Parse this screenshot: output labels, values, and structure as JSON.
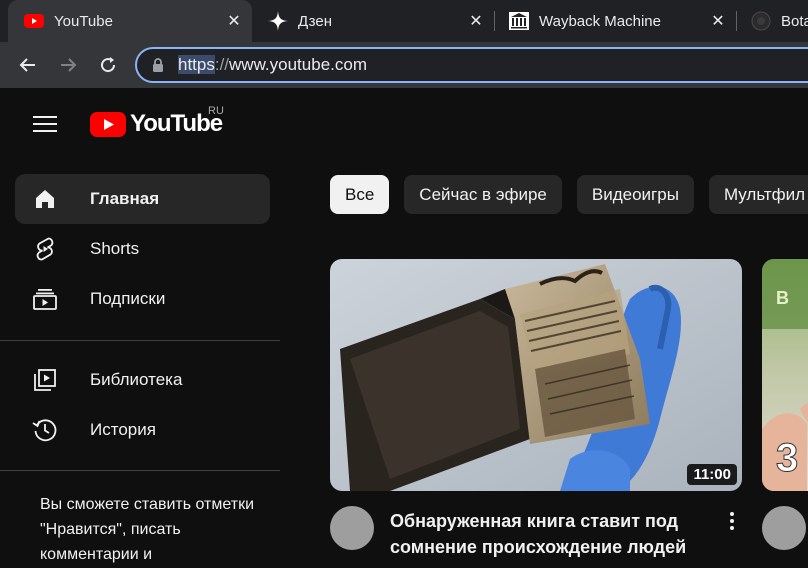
{
  "browser": {
    "tabs": [
      {
        "title": "YouTube",
        "active": true
      },
      {
        "title": "Дзен",
        "active": false
      },
      {
        "title": "Wayback Machine",
        "active": false
      },
      {
        "title": "Bota",
        "active": false
      }
    ],
    "url": {
      "selected": "https",
      "separator": "://",
      "rest": "www.youtube.com"
    }
  },
  "youtube": {
    "logo_text": "YouTube",
    "region": "RU",
    "sidebar": {
      "items": [
        {
          "label": "Главная",
          "icon": "home-icon",
          "active": true
        },
        {
          "label": "Shorts",
          "icon": "shorts-icon",
          "active": false
        },
        {
          "label": "Подписки",
          "icon": "subscriptions-icon",
          "active": false
        },
        {
          "label": "Библиотека",
          "icon": "library-icon",
          "active": false
        },
        {
          "label": "История",
          "icon": "history-icon",
          "active": false
        }
      ],
      "signin_note": "Вы сможете ставить отметки \"Нравится\", писать комментарии и"
    },
    "chips": [
      "Все",
      "Сейчас в эфире",
      "Видеоигры",
      "Мультфил"
    ],
    "videos": [
      {
        "title": "Обнаруженная книга ставит под сомнение происхождение людей",
        "duration": "11:00"
      },
      {
        "duration_partial": "3"
      }
    ]
  },
  "colors": {
    "accent": "#8ab4f8",
    "brand": "#ff0000",
    "background": "#0f0f0f",
    "chip_active": "#f1f1f1"
  }
}
